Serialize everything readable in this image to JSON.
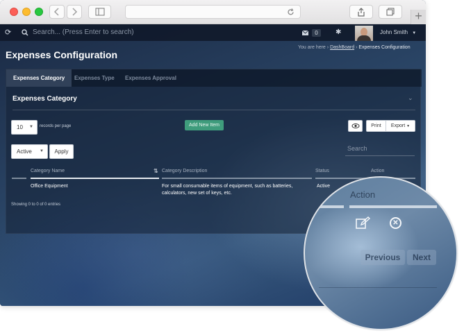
{
  "topbar": {
    "search_placeholder": "Search... (Press Enter to search)",
    "mail_count": "0",
    "user_name": "John Smith"
  },
  "page": {
    "title": "Expenses Configuration",
    "breadcrumb": {
      "prefix": "You are here",
      "link": "DashBoard",
      "current": "Expenses Configuration"
    }
  },
  "tabs": [
    {
      "label": "Expenses Category"
    },
    {
      "label": "Expenses Type"
    },
    {
      "label": "Expenses Approval"
    }
  ],
  "section": {
    "title": "Expenses Category"
  },
  "controls": {
    "page_length": "10",
    "records_per_page": "records per page",
    "add_new": "Add New Item",
    "print": "Print",
    "export": "Export",
    "status_filter": "Active",
    "apply": "Apply",
    "search_placeholder": "Search"
  },
  "table": {
    "headers": [
      "Category Name",
      "Category Description",
      "Status",
      "Action"
    ],
    "rows": [
      {
        "name": "Office Equipment",
        "description_line1": "For small consumable items of equipment, such as batteries,",
        "description_line2": "calculators, new set of keys, etc.",
        "status": "Active"
      }
    ],
    "info": "Showing 0 to 0 of 0 entries"
  },
  "zoom": {
    "action_label": "Action",
    "previous": "Previous",
    "next": "Next"
  },
  "colors": {
    "add_button": "#3f9c7c",
    "topbar": "#0f1828"
  }
}
